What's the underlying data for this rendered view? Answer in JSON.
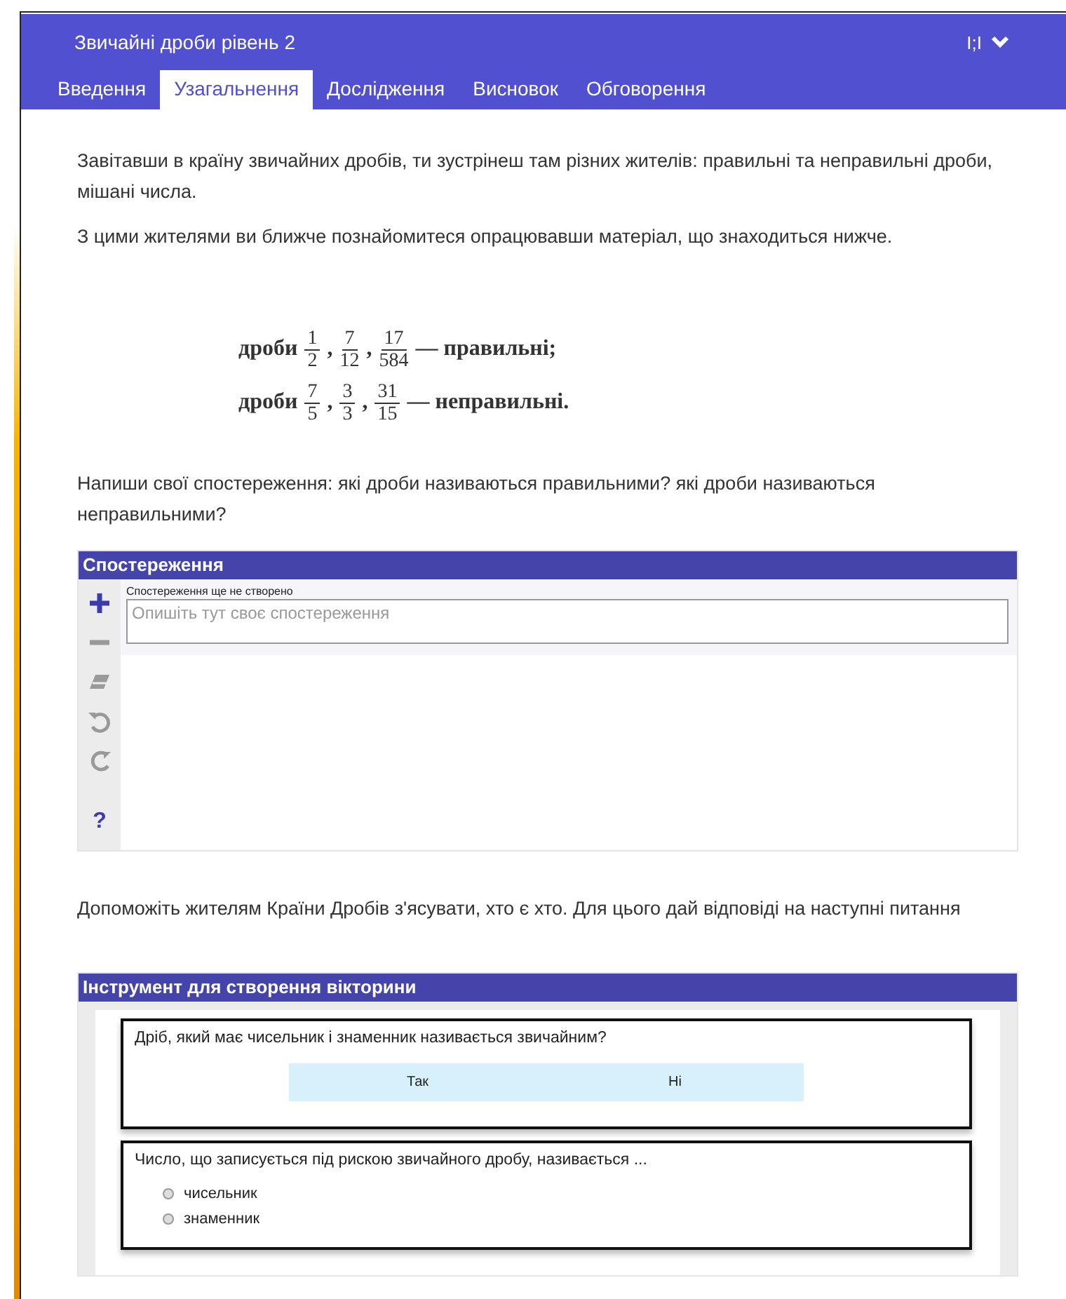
{
  "header": {
    "title": "Звичайні дроби рівень 2",
    "glyph": "I;I",
    "expanded": false
  },
  "tabs": [
    {
      "label": "Введення",
      "selected": false
    },
    {
      "label": "Узагальнення",
      "selected": true
    },
    {
      "label": "Дослідження",
      "selected": false
    },
    {
      "label": "Висновок",
      "selected": false
    },
    {
      "label": "Обговорення",
      "selected": false
    }
  ],
  "intro_paragraphs": [
    "Завітавши в країну звичайних дробів, ти зустрінеш там різних жителів: правильні та неправильні дроби, мішані числа.",
    "З цими жителями ви ближче познайомитеся опрацювавши матеріал, що знаходиться нижче."
  ],
  "fraction_lines": [
    {
      "parts": [
        {
          "kind": "text",
          "text": "дроби"
        },
        {
          "kind": "fraction",
          "numerator": "1",
          "denominator": "2"
        },
        {
          "kind": "text",
          "text": ","
        },
        {
          "kind": "fraction",
          "numerator": "7",
          "denominator": "12"
        },
        {
          "kind": "text",
          "text": ","
        },
        {
          "kind": "fraction",
          "numerator": "17",
          "denominator": "584"
        },
        {
          "kind": "text",
          "text": "— правильні;"
        }
      ]
    },
    {
      "parts": [
        {
          "kind": "text",
          "text": "дроби"
        },
        {
          "kind": "fraction",
          "numerator": "7",
          "denominator": "5"
        },
        {
          "kind": "text",
          "text": ","
        },
        {
          "kind": "fraction",
          "numerator": "3",
          "denominator": "3"
        },
        {
          "kind": "text",
          "text": ","
        },
        {
          "kind": "fraction",
          "numerator": "31",
          "denominator": "15"
        },
        {
          "kind": "text",
          "text": "— неправильні."
        }
      ]
    }
  ],
  "prompt": "Напиши свої спостереження: які дроби називаються правильними? які дроби називаються неправильними?",
  "observations": {
    "title": "Спостереження",
    "tools": [
      {
        "kind": "add",
        "disabled": false
      },
      {
        "kind": "remove",
        "disabled": true
      },
      {
        "kind": "erase",
        "disabled": true
      },
      {
        "kind": "undo",
        "disabled": true
      },
      {
        "kind": "redo",
        "disabled": true
      },
      {
        "kind": "help",
        "glyph": "?",
        "disabled": false
      }
    ],
    "status": "Спостереження ще не створено",
    "placeholder": "Опишіть тут своє спостереження"
  },
  "prompt_2": "Допоможіть жителям Країни Дробів з'ясувати, хто є хто. Для цього дай відповіді на наступні питання",
  "quiz": {
    "title": "Інструмент для створення вікторини",
    "questions": [
      {
        "kind": "buttons",
        "text": "Дріб, який має чисельник і знаменник називається звичайним?",
        "options": [
          {
            "label": "Так",
            "selected": false
          },
          {
            "label": "Ні",
            "selected": false
          }
        ]
      },
      {
        "kind": "radio",
        "text": "Число, що записується під рискою звичайного дробу, називається ...",
        "options": [
          {
            "label": "чисельник",
            "selected": false
          },
          {
            "label": "знаменник",
            "selected": false
          }
        ]
      }
    ]
  }
}
